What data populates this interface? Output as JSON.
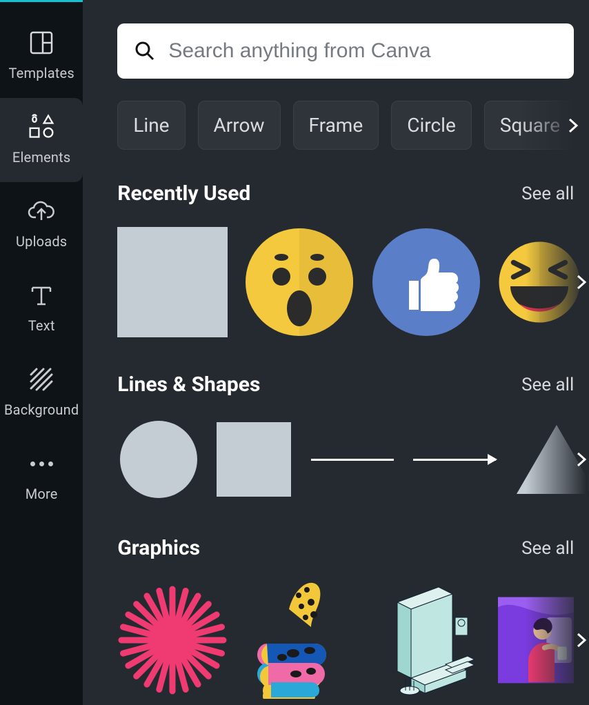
{
  "search": {
    "placeholder": "Search anything from Canva"
  },
  "sidebar": {
    "items": [
      {
        "label": "Templates"
      },
      {
        "label": "Elements"
      },
      {
        "label": "Uploads"
      },
      {
        "label": "Text"
      },
      {
        "label": "Background"
      },
      {
        "label": "More"
      }
    ]
  },
  "chips": [
    "Line",
    "Arrow",
    "Frame",
    "Circle",
    "Square"
  ],
  "sections": {
    "recent": {
      "title": "Recently Used",
      "see_all": "See all"
    },
    "lines": {
      "title": "Lines & Shapes",
      "see_all": "See all"
    },
    "graphics": {
      "title": "Graphics",
      "see_all": "See all"
    }
  }
}
